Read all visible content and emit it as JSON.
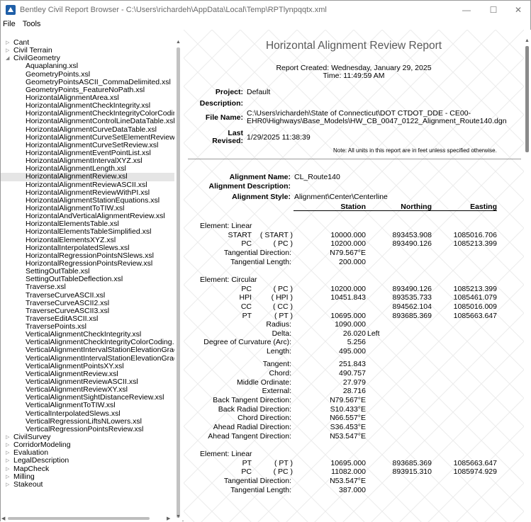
{
  "window": {
    "title": "Bentley Civil Report Browser - C:\\Users\\richardeh\\AppData\\Local\\Temp\\RPTlynpqqtx.xml",
    "minimize": "—",
    "maximize": "☐",
    "close": "✕"
  },
  "menu": [
    "File",
    "Tools"
  ],
  "tree": [
    {
      "label": "Cant",
      "level": 0,
      "expander": "▷"
    },
    {
      "label": "Civil Terrain",
      "level": 0,
      "expander": "▷"
    },
    {
      "label": "CivilGeometry",
      "level": 0,
      "expander": "◢"
    },
    {
      "label": "Aquaplaning.xsl",
      "level": 1
    },
    {
      "label": "GeometryPoints.xsl",
      "level": 1
    },
    {
      "label": "GeometryPointsASCII_CommaDelimited.xsl",
      "level": 1
    },
    {
      "label": "GeometryPoints_FeatureNoPath.xsl",
      "level": 1
    },
    {
      "label": "HorizontalAlignmentArea.xsl",
      "level": 1
    },
    {
      "label": "HorizontalAlignmentCheckIntegrity.xsl",
      "level": 1
    },
    {
      "label": "HorizontalAlignmentCheckIntegrityColorCoding.x",
      "level": 1
    },
    {
      "label": "HorizontalAlignmentControlLineDataTable.xsl",
      "level": 1
    },
    {
      "label": "HorizontalAlignmentCurveDataTable.xsl",
      "level": 1
    },
    {
      "label": "HorizontalAlignmentCurveSetElementReview.xsl",
      "level": 1
    },
    {
      "label": "HorizontalAlignmentCurveSetReview.xsl",
      "level": 1
    },
    {
      "label": "HorizontalAlignmentEventPointList.xsl",
      "level": 1
    },
    {
      "label": "HorizontalAlignmentIntervalXYZ.xsl",
      "level": 1
    },
    {
      "label": "HorizontalAlignmentLength.xsl",
      "level": 1
    },
    {
      "label": "HorizontalAlignmentReview.xsl",
      "level": 1,
      "selected": true
    },
    {
      "label": "HorizontalAlignmentReviewASCII.xsl",
      "level": 1
    },
    {
      "label": "HorizontalAlignmentReviewWithPI.xsl",
      "level": 1
    },
    {
      "label": "HorizontalAlignmentStationEquations.xsl",
      "level": 1
    },
    {
      "label": "HorizontalAlignmentToTIW.xsl",
      "level": 1
    },
    {
      "label": "HorizontalAndVerticalAlignmentReview.xsl",
      "level": 1
    },
    {
      "label": "HorizontalElementsTable.xsl",
      "level": 1
    },
    {
      "label": "HorizontalElementsTableSimplified.xsl",
      "level": 1
    },
    {
      "label": "HorizontalElementsXYZ.xsl",
      "level": 1
    },
    {
      "label": "HorizontalInterpolatedSlews.xsl",
      "level": 1
    },
    {
      "label": "HorizontalRegressionPointsNSlews.xsl",
      "level": 1
    },
    {
      "label": "HorizontalRegressionPointsReview.xsl",
      "level": 1
    },
    {
      "label": "SettingOutTable.xsl",
      "level": 1
    },
    {
      "label": "SettingOutTableDeflection.xsl",
      "level": 1
    },
    {
      "label": "Traverse.xsl",
      "level": 1
    },
    {
      "label": "TraverseCurveASCII.xsl",
      "level": 1
    },
    {
      "label": "TraverseCurveASCII2.xsl",
      "level": 1
    },
    {
      "label": "TraverseCurveASCII3.xsl",
      "level": 1
    },
    {
      "label": "TraverseEditASCII.xsl",
      "level": 1
    },
    {
      "label": "TraversePoints.xsl",
      "level": 1
    },
    {
      "label": "VerticalAlignmentCheckIntegrity.xsl",
      "level": 1
    },
    {
      "label": "VerticalAlignmentCheckIntegrityColorCoding.xsl",
      "level": 1
    },
    {
      "label": "VerticalAlignmentIntervalStationElevationGrade.xs",
      "level": 1
    },
    {
      "label": "VerticalAlignmentIntervalStationElevationGradeAS",
      "level": 1
    },
    {
      "label": "VerticalAlignmentPointsXY.xsl",
      "level": 1
    },
    {
      "label": "VerticalAlignmentReview.xsl",
      "level": 1
    },
    {
      "label": "VerticalAlignmentReviewASCII.xsl",
      "level": 1
    },
    {
      "label": "VerticalAlignmentReviewXY.xsl",
      "level": 1
    },
    {
      "label": "VerticalAlignmentSightDistanceReview.xsl",
      "level": 1
    },
    {
      "label": "VerticalAlignmentToTIW.xsl",
      "level": 1
    },
    {
      "label": "VerticalInterpolatedSlews.xsl",
      "level": 1
    },
    {
      "label": "VerticalRegressionLiftsNLowers.xsl",
      "level": 1
    },
    {
      "label": "VerticalRegressionPointsReview.xsl",
      "level": 1
    },
    {
      "label": "CivilSurvey",
      "level": 0,
      "expander": "▷"
    },
    {
      "label": "CorridorModeling",
      "level": 0,
      "expander": "▷"
    },
    {
      "label": "Evaluation",
      "level": 0,
      "expander": "▷"
    },
    {
      "label": "LegalDescription",
      "level": 0,
      "expander": "▷"
    },
    {
      "label": "MapCheck",
      "level": 0,
      "expander": "▷"
    },
    {
      "label": "Milling",
      "level": 0,
      "expander": "▷"
    },
    {
      "label": "Stakeout",
      "level": 0,
      "expander": "▷"
    }
  ],
  "report": {
    "title": "Horizontal Alignment Review Report",
    "created_line": "Report Created:  Wednesday, January 29, 2025",
    "time_line": "Time:  11:49:59 AM",
    "project_label": "Project:",
    "project_value": "Default",
    "description_label": "Description:",
    "description_value": "",
    "file_label": "File Name:",
    "file_value_1": "C:\\Users\\richardeh\\State of Connecticut\\DOT CTDOT_DDE - CE00-",
    "file_value_2": "EHR0\\Highways\\Base_Models\\HW_CB_0047_0122_Alignment_Route140.dgn",
    "last_label_1": "Last",
    "last_label_2": "Revised:",
    "last_value": "1/29/2025 11:38:39",
    "note": "Note:  All units in this report are in feet unless specified otherwise.",
    "alignment_name_label": "Alignment Name:",
    "alignment_name_value": "CL_Route140",
    "alignment_desc_label": "Alignment Description:",
    "alignment_desc_value": "",
    "alignment_style_label": "Alignment Style:",
    "alignment_style_value": "Alignment\\Center\\Centerline",
    "col_station": "Station",
    "col_northing": "Northing",
    "col_easting": "Easting",
    "rows": [
      {
        "kind": "section",
        "text": "Element: Linear"
      },
      {
        "kind": "point",
        "name": "START",
        "code": "( START )",
        "station": "10000.000",
        "northing": "893453.908",
        "easting": "1085016.706"
      },
      {
        "kind": "point",
        "name": "PC",
        "code": "( PC )",
        "station": "10200.000",
        "northing": "893490.126",
        "easting": "1085213.399"
      },
      {
        "kind": "prop",
        "label": "Tangential Direction:",
        "value": "N79.567°E"
      },
      {
        "kind": "prop",
        "label": "Tangential Length:",
        "value": "200.000"
      },
      {
        "kind": "gap"
      },
      {
        "kind": "section",
        "text": "Element: Circular"
      },
      {
        "kind": "point",
        "name": "PC",
        "code": "( PC )",
        "station": "10200.000",
        "northing": "893490.126",
        "easting": "1085213.399"
      },
      {
        "kind": "point",
        "name": "HPI",
        "code": "( HPI )",
        "station": "10451.843",
        "northing": "893535.733",
        "easting": "1085461.079"
      },
      {
        "kind": "point",
        "name": "CC",
        "code": "( CC )",
        "station": "",
        "northing": "894562.104",
        "easting": "1085016.009"
      },
      {
        "kind": "point",
        "name": "PT",
        "code": "( PT )",
        "station": "10695.000",
        "northing": "893685.369",
        "easting": "1085663.647"
      },
      {
        "kind": "prop",
        "label": "Radius:",
        "value": "1090.000"
      },
      {
        "kind": "prop",
        "label": "Delta:",
        "value": "26.020",
        "suffix": "Left"
      },
      {
        "kind": "prop",
        "label": "Degree of Curvature (Arc):",
        "value": "5.256"
      },
      {
        "kind": "prop",
        "label": "Length:",
        "value": "495.000"
      },
      {
        "kind": "halfgap"
      },
      {
        "kind": "prop",
        "label": "Tangent:",
        "value": "251.843"
      },
      {
        "kind": "prop",
        "label": "Chord:",
        "value": "490.757"
      },
      {
        "kind": "prop",
        "label": "Middle Ordinate:",
        "value": "27.979"
      },
      {
        "kind": "prop",
        "label": "External:",
        "value": "28.716"
      },
      {
        "kind": "prop",
        "label": "Back Tangent Direction:",
        "value": "N79.567°E"
      },
      {
        "kind": "prop",
        "label": "Back Radial Direction:",
        "value": "S10.433°E"
      },
      {
        "kind": "prop",
        "label": "Chord Direction:",
        "value": "N66.557°E"
      },
      {
        "kind": "prop",
        "label": "Ahead Radial Direction:",
        "value": "S36.453°E"
      },
      {
        "kind": "prop",
        "label": "Ahead Tangent Direction:",
        "value": "N53.547°E"
      },
      {
        "kind": "gap"
      },
      {
        "kind": "section",
        "text": "Element: Linear"
      },
      {
        "kind": "point",
        "name": "PT",
        "code": "( PT )",
        "station": "10695.000",
        "northing": "893685.369",
        "easting": "1085663.647"
      },
      {
        "kind": "point",
        "name": "PC",
        "code": "( PC )",
        "station": "11082.000",
        "northing": "893915.310",
        "easting": "1085974.929"
      },
      {
        "kind": "prop",
        "label": "Tangential Direction:",
        "value": "N53.547°E"
      },
      {
        "kind": "prop",
        "label": "Tangential Length:",
        "value": "387.000"
      }
    ]
  }
}
